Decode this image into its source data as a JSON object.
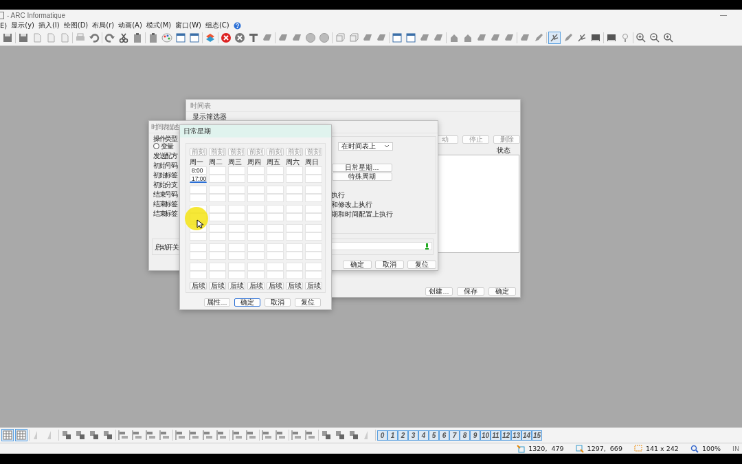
{
  "window": {
    "title": "- ARC Informatique"
  },
  "menu": [
    "E)",
    "显示(y)",
    "插入(I)",
    "绘图(D)",
    "布局(r)",
    "动画(A)",
    "模式(M)",
    "窗口(W)",
    "组态(C)"
  ],
  "schedule_window": {
    "title": "时间表",
    "filter_label": "显示筛选器",
    "top_buttons": [
      "动",
      "停止",
      "删除"
    ],
    "column_header": "状态",
    "buttons": [
      "创建...",
      "保存",
      "确定"
    ]
  },
  "description_window": {
    "title": "时间表描述",
    "operation_label": "操作类型",
    "radio": {
      "label": "变量",
      "selected": false
    },
    "labels": [
      "发送配方",
      "初始号码",
      "初始标签",
      "初始分支",
      "结束号码",
      "结束标签",
      "结束标签"
    ],
    "switch_label": "启动开关",
    "dropdown": "在时间表上",
    "period_buttons": [
      "日常星期...",
      "特殊周期"
    ],
    "options": [
      "执行",
      "和修改上执行",
      "期和时间配置上执行"
    ],
    "buttons": [
      "确定",
      "取消",
      "复位"
    ]
  },
  "weekly_dialog": {
    "title": "日常星期",
    "days": [
      {
        "label": "周一",
        "before": "前刻",
        "after": "后续",
        "times": [
          "8:00",
          "17:00"
        ]
      },
      {
        "label": "周二",
        "before": "前刻",
        "after": "后续"
      },
      {
        "label": "周三",
        "before": "前刻",
        "after": "后续"
      },
      {
        "label": "周四",
        "before": "前刻",
        "after": "后续"
      },
      {
        "label": "周五",
        "before": "前刻",
        "after": "后续"
      },
      {
        "label": "周六",
        "before": "前刻",
        "after": "后续"
      },
      {
        "label": "周日",
        "before": "前刻",
        "after": "后续"
      }
    ],
    "buttons": [
      {
        "label": "属性...",
        "selected": false
      },
      {
        "label": "确定",
        "selected": true
      },
      {
        "label": "取消",
        "selected": false
      },
      {
        "label": "复位",
        "selected": false
      }
    ]
  },
  "layer_buttons": [
    "0",
    "1",
    "2",
    "3",
    "4",
    "5",
    "6",
    "7",
    "8",
    "9",
    "10",
    "11",
    "12",
    "13",
    "14",
    "15"
  ],
  "status_bar": {
    "position": "1320,  479",
    "corner": "1297,  669",
    "size": "141 x 242",
    "zoom": "100%",
    "mode": "IN"
  }
}
